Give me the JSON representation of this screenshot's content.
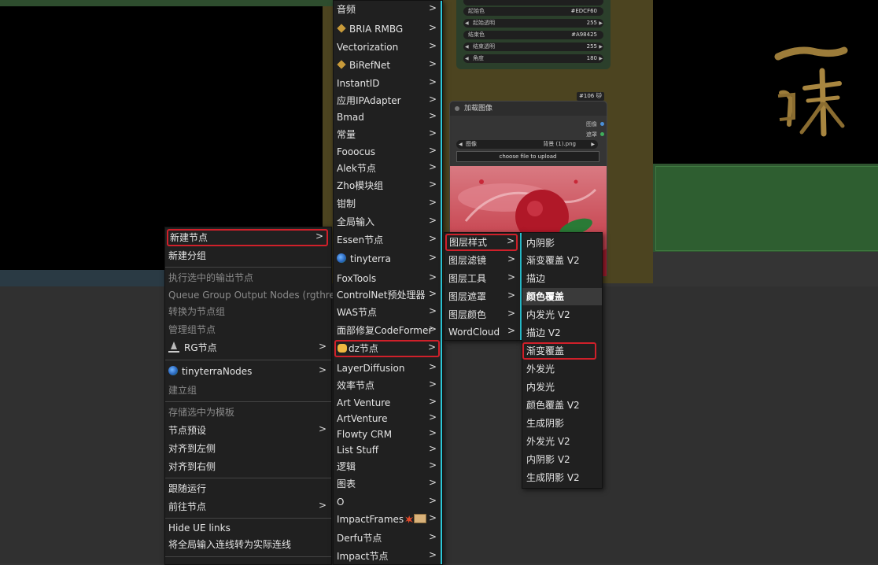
{
  "gradient_node": {
    "rows": [
      {
        "label": "起始色",
        "value": "#EDCF60",
        "has_arrows": false
      },
      {
        "label": "起始透明",
        "value": "255",
        "has_arrows": true
      },
      {
        "label": "结束色",
        "value": "#A98425",
        "has_arrows": false
      },
      {
        "label": "结束透明",
        "value": "255",
        "has_arrows": true
      },
      {
        "label": "角度",
        "value": "180",
        "has_arrows": true
      }
    ]
  },
  "load_image_node": {
    "id_badge": "#106 🐱",
    "title": "加载图像",
    "outputs": [
      "图像",
      "遮罩"
    ],
    "image_select": {
      "label": "图像",
      "value": "背景 (1).png"
    },
    "upload_label": "choose file to upload"
  },
  "menu_main": {
    "items": [
      {
        "label": "新建节点",
        "submenu": true,
        "disabled": false,
        "highlighted": true
      },
      {
        "label": "新建分组",
        "submenu": false,
        "disabled": false
      },
      {
        "label": "执行选中的输出节点",
        "submenu": false,
        "disabled": true
      },
      {
        "label": "Queue Group Output Nodes (rgthree)",
        "submenu": false,
        "disabled": true
      },
      {
        "label": "转换为节点组",
        "submenu": false,
        "disabled": true
      },
      {
        "label": "管理组节点",
        "submenu": false,
        "disabled": true
      },
      {
        "label": "RG节点",
        "submenu": true,
        "disabled": false,
        "icon": "rg-icon"
      },
      {
        "label": "tinyterraNodes",
        "submenu": true,
        "disabled": false,
        "icon": "globe-icon"
      },
      {
        "label": "建立组",
        "submenu": false,
        "disabled": true
      },
      {
        "label": "存储选中为模板",
        "submenu": false,
        "disabled": true
      },
      {
        "label": "节点预设",
        "submenu": true,
        "disabled": false
      },
      {
        "label": "对齐到左侧",
        "submenu": false,
        "disabled": false
      },
      {
        "label": "对齐到右侧",
        "submenu": false,
        "disabled": false
      },
      {
        "label": "跟随运行",
        "submenu": false,
        "disabled": false
      },
      {
        "label": "前往节点",
        "submenu": true,
        "disabled": false
      },
      {
        "label": "Hide UE links",
        "submenu": false,
        "disabled": false
      },
      {
        "label": "将全局输入连线转为实际连线",
        "submenu": false,
        "disabled": false
      }
    ]
  },
  "menu_categories": {
    "items": [
      {
        "label": "音频"
      },
      {
        "label": "BRIA RMBG",
        "icon": "brush-icon"
      },
      {
        "label": "Vectorization"
      },
      {
        "label": "BiRefNet",
        "icon": "brush-icon"
      },
      {
        "label": "InstantID"
      },
      {
        "label": "应用IPAdapter"
      },
      {
        "label": "Bmad"
      },
      {
        "label": "常量"
      },
      {
        "label": "Fooocus"
      },
      {
        "label": "Alek节点"
      },
      {
        "label": "Zho模块组"
      },
      {
        "label": "钳制"
      },
      {
        "label": "全局输入"
      },
      {
        "label": "Essen节点"
      },
      {
        "label": "tinyterra",
        "icon": "globe-icon"
      },
      {
        "label": "FoxTools"
      },
      {
        "label": "ControlNet预处理器"
      },
      {
        "label": "WAS节点"
      },
      {
        "label": "面部修复CodeFormer"
      },
      {
        "label": "dz节点",
        "icon": "cat-icon",
        "highlighted": true
      },
      {
        "label": "LayerDiffusion"
      },
      {
        "label": "效率节点"
      },
      {
        "label": "Art Venture"
      },
      {
        "label": "ArtVenture"
      },
      {
        "label": "Flowty CRM"
      },
      {
        "label": "List Stuff"
      },
      {
        "label": "逻辑"
      },
      {
        "label": "图表"
      },
      {
        "label": "O"
      },
      {
        "label": "ImpactFrames",
        "icon": "impactframes-icons"
      },
      {
        "label": "Derfu节点"
      },
      {
        "label": "Impact节点"
      }
    ]
  },
  "menu_dz": {
    "items": [
      {
        "label": "图层样式",
        "highlighted": true
      },
      {
        "label": "图层滤镜"
      },
      {
        "label": "图层工具"
      },
      {
        "label": "图层遮罩"
      },
      {
        "label": "图层颜色"
      },
      {
        "label": "WordCloud"
      }
    ]
  },
  "menu_layer_style": {
    "items": [
      {
        "label": "内阴影"
      },
      {
        "label": "渐变覆盖 V2"
      },
      {
        "label": "描边"
      },
      {
        "label": "颜色覆盖",
        "hovered": true
      },
      {
        "label": "内发光 V2"
      },
      {
        "label": "描边 V2"
      },
      {
        "label": "渐变覆盖",
        "highlighted": true
      },
      {
        "label": "外发光"
      },
      {
        "label": "内发光"
      },
      {
        "label": "颜色覆盖 V2"
      },
      {
        "label": "生成阴影"
      },
      {
        "label": "外发光 V2"
      },
      {
        "label": "内阴影 V2"
      },
      {
        "label": "生成阴影 V2"
      }
    ]
  },
  "colors": {
    "highlight_outline": "#d0202a",
    "menu_bg": "#202020",
    "submenu_accent": "#2cc8d8",
    "image_output_dot": "#4a8fd8",
    "mask_output_dot": "#3fae5a"
  }
}
